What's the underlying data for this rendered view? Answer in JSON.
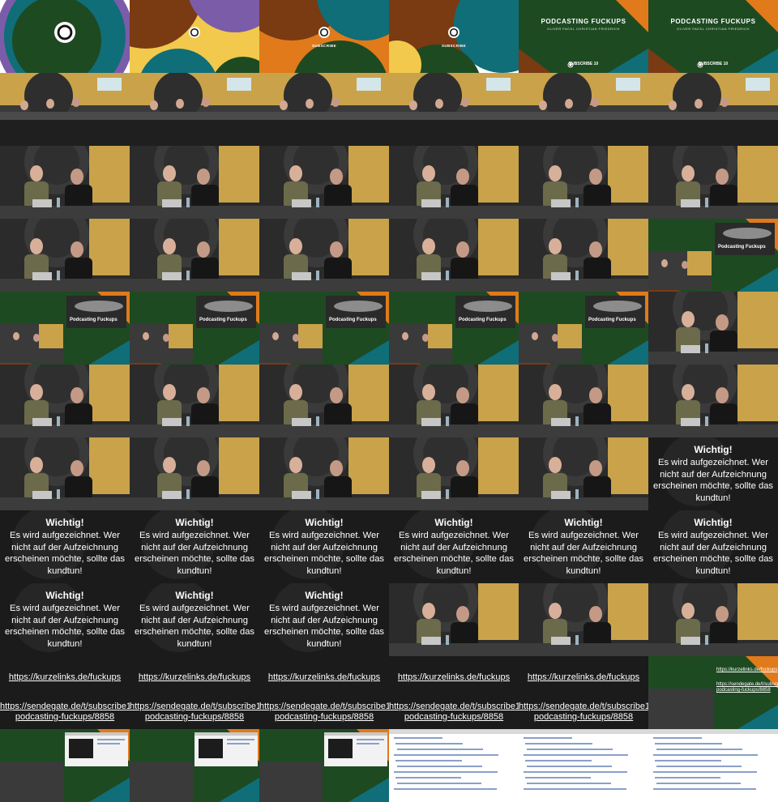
{
  "sheet": {
    "columns": 6,
    "rows": 11,
    "podcast_title": "PODCASTING FUCKUPS",
    "podcast_authors": "OLIVER FACKL  CHRISTIAN FRIEDRICH",
    "subscribe_label": "SUBSCRIBE",
    "subscribe_label_full": "SUBSCRIBE 10",
    "slide_title": "Podcasting Fuckups",
    "warning_heading": "Wichtig!",
    "warning_body": "Es wird aufgezeichnet. Wer nicht auf der Aufzeichnung erscheinen möchte, sollte das kundtun!",
    "link_short": "https://kurzelinks.de/fuckups",
    "link_long": "https://sendegate.de/t/subscribe10-podcasting-fuckups/8858",
    "link_short_mini": "https://kurzelinks.de/fuckups",
    "link_long_mini": "https://sendegate.de/t/subscribe10-podcasting-fuckups/8858",
    "colors": {
      "brand_green": "#1e4a22",
      "brand_teal": "#0f6e78",
      "brand_purple": "#7b5ca8",
      "brand_brown": "#7a3a12",
      "brand_orange": "#e07a1a",
      "brand_yellow": "#f2c94c",
      "room_wall": "#c9a24a",
      "room_dark": "#2b2b2b"
    }
  }
}
